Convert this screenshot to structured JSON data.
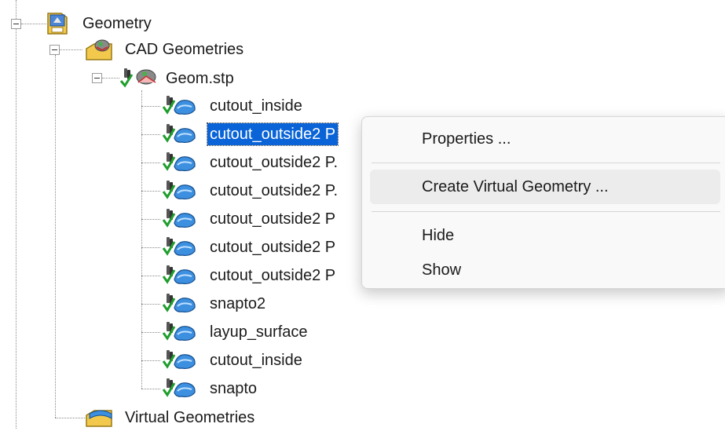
{
  "tree": {
    "root": {
      "label": "Geometry",
      "icon": "geometry-folder-icon"
    },
    "cad_geometries": {
      "label": "CAD Geometries",
      "icon": "cad-geometries-icon"
    },
    "file": {
      "label": "Geom.stp",
      "icon": "step-file-icon"
    },
    "parts": [
      {
        "label": "cutout_inside",
        "selected": false
      },
      {
        "label": "cutout_outside2 P",
        "selected": true
      },
      {
        "label": "cutout_outside2 P.",
        "selected": false
      },
      {
        "label": "cutout_outside2 P.",
        "selected": false
      },
      {
        "label": "cutout_outside2 P",
        "selected": false
      },
      {
        "label": "cutout_outside2 P",
        "selected": false
      },
      {
        "label": "cutout_outside2 P",
        "selected": false
      },
      {
        "label": "snapto2",
        "selected": false
      },
      {
        "label": "layup_surface",
        "selected": false
      },
      {
        "label": "cutout_inside",
        "selected": false
      },
      {
        "label": "snapto",
        "selected": false
      }
    ],
    "virtual_geometries": {
      "label": "Virtual Geometries",
      "icon": "virtual-geometries-icon"
    }
  },
  "context_menu": {
    "items": [
      {
        "label": "Properties ...",
        "hover": false
      },
      {
        "label": "Create Virtual Geometry ...",
        "hover": true
      },
      {
        "label": "Hide",
        "hover": false
      },
      {
        "label": "Show",
        "hover": false
      }
    ]
  },
  "colors": {
    "selection": "#0a64d8",
    "check": "#1f9e2c",
    "surface": "#3d8fe0",
    "menu_bg": "#f9f9f9",
    "menu_hover": "#ececec"
  }
}
